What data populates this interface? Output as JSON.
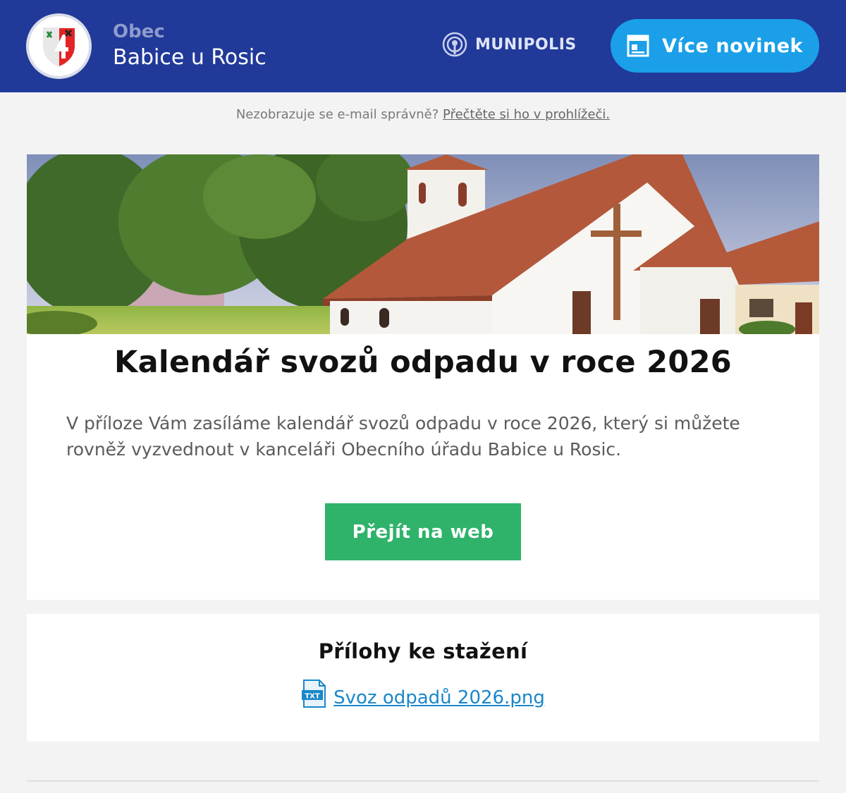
{
  "header": {
    "obec_label": "Obec",
    "municipality_name": "Babice u Rosic",
    "partner_logo_text": "MUNIPOLIS",
    "more_news_label": "Více novinek"
  },
  "browser_notice": {
    "text": "Nezobrazuje se e-mail správně?",
    "link_label": "Přečtěte si ho v prohlížeči."
  },
  "article": {
    "title": "Kalendář svozů odpadu v roce 2026",
    "body": "V příloze Vám zasíláme kalendář svozů odpadu v roce 2026, který si můžete rovněž vyzvednout v kanceláři Obecního úřadu Babice u Rosic.",
    "cta_label": "Přejít na web"
  },
  "attachments": {
    "title": "Přílohy ke stažení",
    "files": [
      {
        "name": "Svoz odpadů 2026.png",
        "icon": "txt-file-icon",
        "icon_text": "TXT"
      }
    ]
  },
  "colors": {
    "header_bg": "#213999",
    "button_blue": "#1a9fe8",
    "cta_green": "#2fb36a",
    "link_blue": "#1a87c9"
  }
}
